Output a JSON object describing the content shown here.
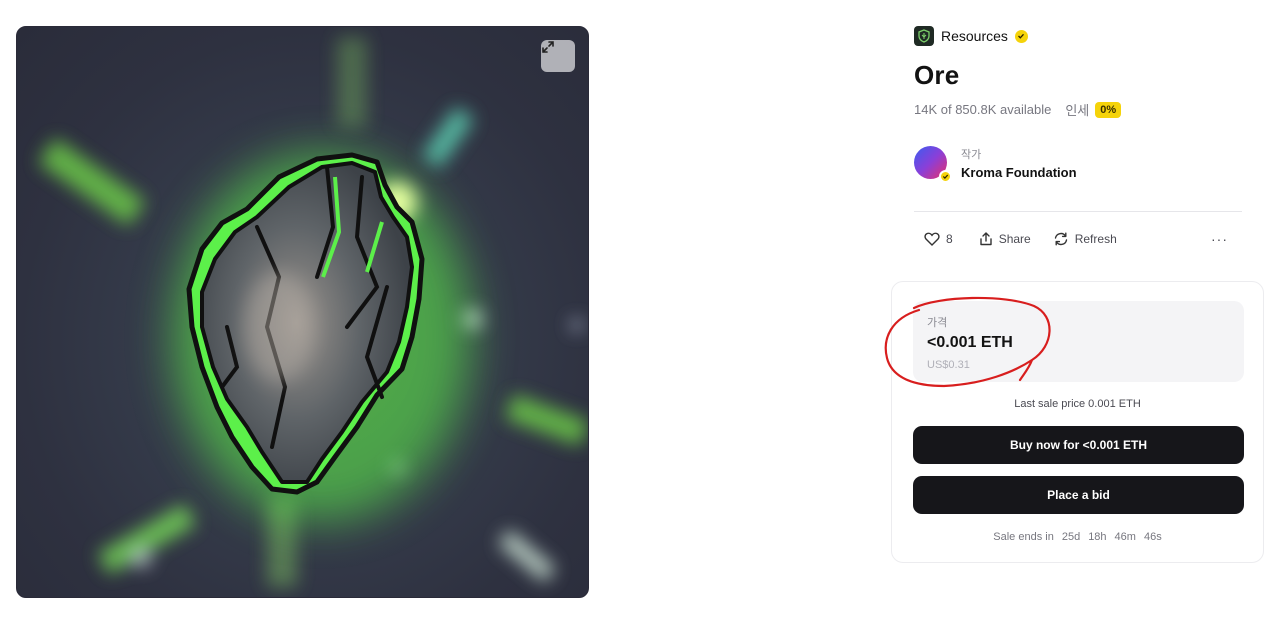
{
  "collection": {
    "name": "Resources",
    "logo_icon": "leaf-shield-icon",
    "verified": true
  },
  "item": {
    "title": "Ore",
    "availability": "14K of 850.8K available",
    "royalty_label": "인세",
    "royalty_value": "0%"
  },
  "creator": {
    "label": "작가",
    "name": "Kroma Foundation",
    "verified": true
  },
  "actions": {
    "likes_count": "8",
    "share_label": "Share",
    "refresh_label": "Refresh",
    "more_label": "···"
  },
  "price": {
    "label": "가격",
    "value": "<0.001 ETH",
    "usd": "US$0.31",
    "last_sale": "Last sale price 0.001 ETH"
  },
  "buttons": {
    "buy_now": "Buy now for <0.001 ETH",
    "place_bid": "Place a bid"
  },
  "sale_end": {
    "label": "Sale ends in",
    "days": "25d",
    "hours": "18h",
    "minutes": "46m",
    "seconds": "46s"
  },
  "colors": {
    "accent_yellow": "#f5d30a",
    "button_dark": "#16161a",
    "ore_glow": "#5cf04a",
    "annotation_red": "#d81e1e"
  }
}
